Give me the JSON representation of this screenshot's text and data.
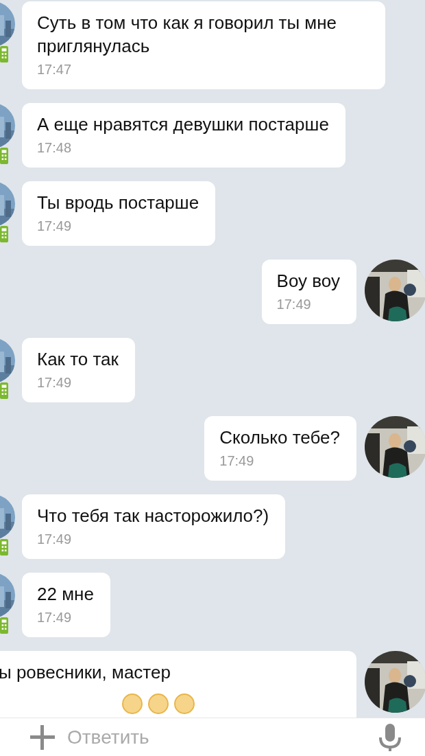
{
  "messages": [
    {
      "kind": "incoming",
      "text": "Суть в том что как я говорил ты мне приглянулась",
      "time": "17:47",
      "mobile": true
    },
    {
      "kind": "incoming",
      "text": "А еще нравятся девушки постарше",
      "time": "17:48",
      "mobile": true
    },
    {
      "kind": "incoming",
      "text": "Ты вродь постарше",
      "time": "17:49",
      "mobile": true
    },
    {
      "kind": "outgoing",
      "text": "Воу воу",
      "time": "17:49"
    },
    {
      "kind": "incoming",
      "text": "Как то так",
      "time": "17:49",
      "mobile": true
    },
    {
      "kind": "outgoing",
      "text": "Сколько тебе?",
      "time": "17:49"
    },
    {
      "kind": "incoming",
      "text": "Что тебя так насторожило?)",
      "time": "17:49",
      "mobile": true
    },
    {
      "kind": "incoming",
      "text": "22 мне",
      "time": "17:49",
      "mobile": true
    },
    {
      "kind": "outgoing",
      "text": "ы ровесники,  мастер",
      "clipped_left": true,
      "emojis": [
        {
          "kind": "smile"
        },
        {
          "kind": "smile"
        },
        {
          "kind": "smile"
        }
      ]
    }
  ],
  "composer": {
    "placeholder": "Ответить"
  }
}
